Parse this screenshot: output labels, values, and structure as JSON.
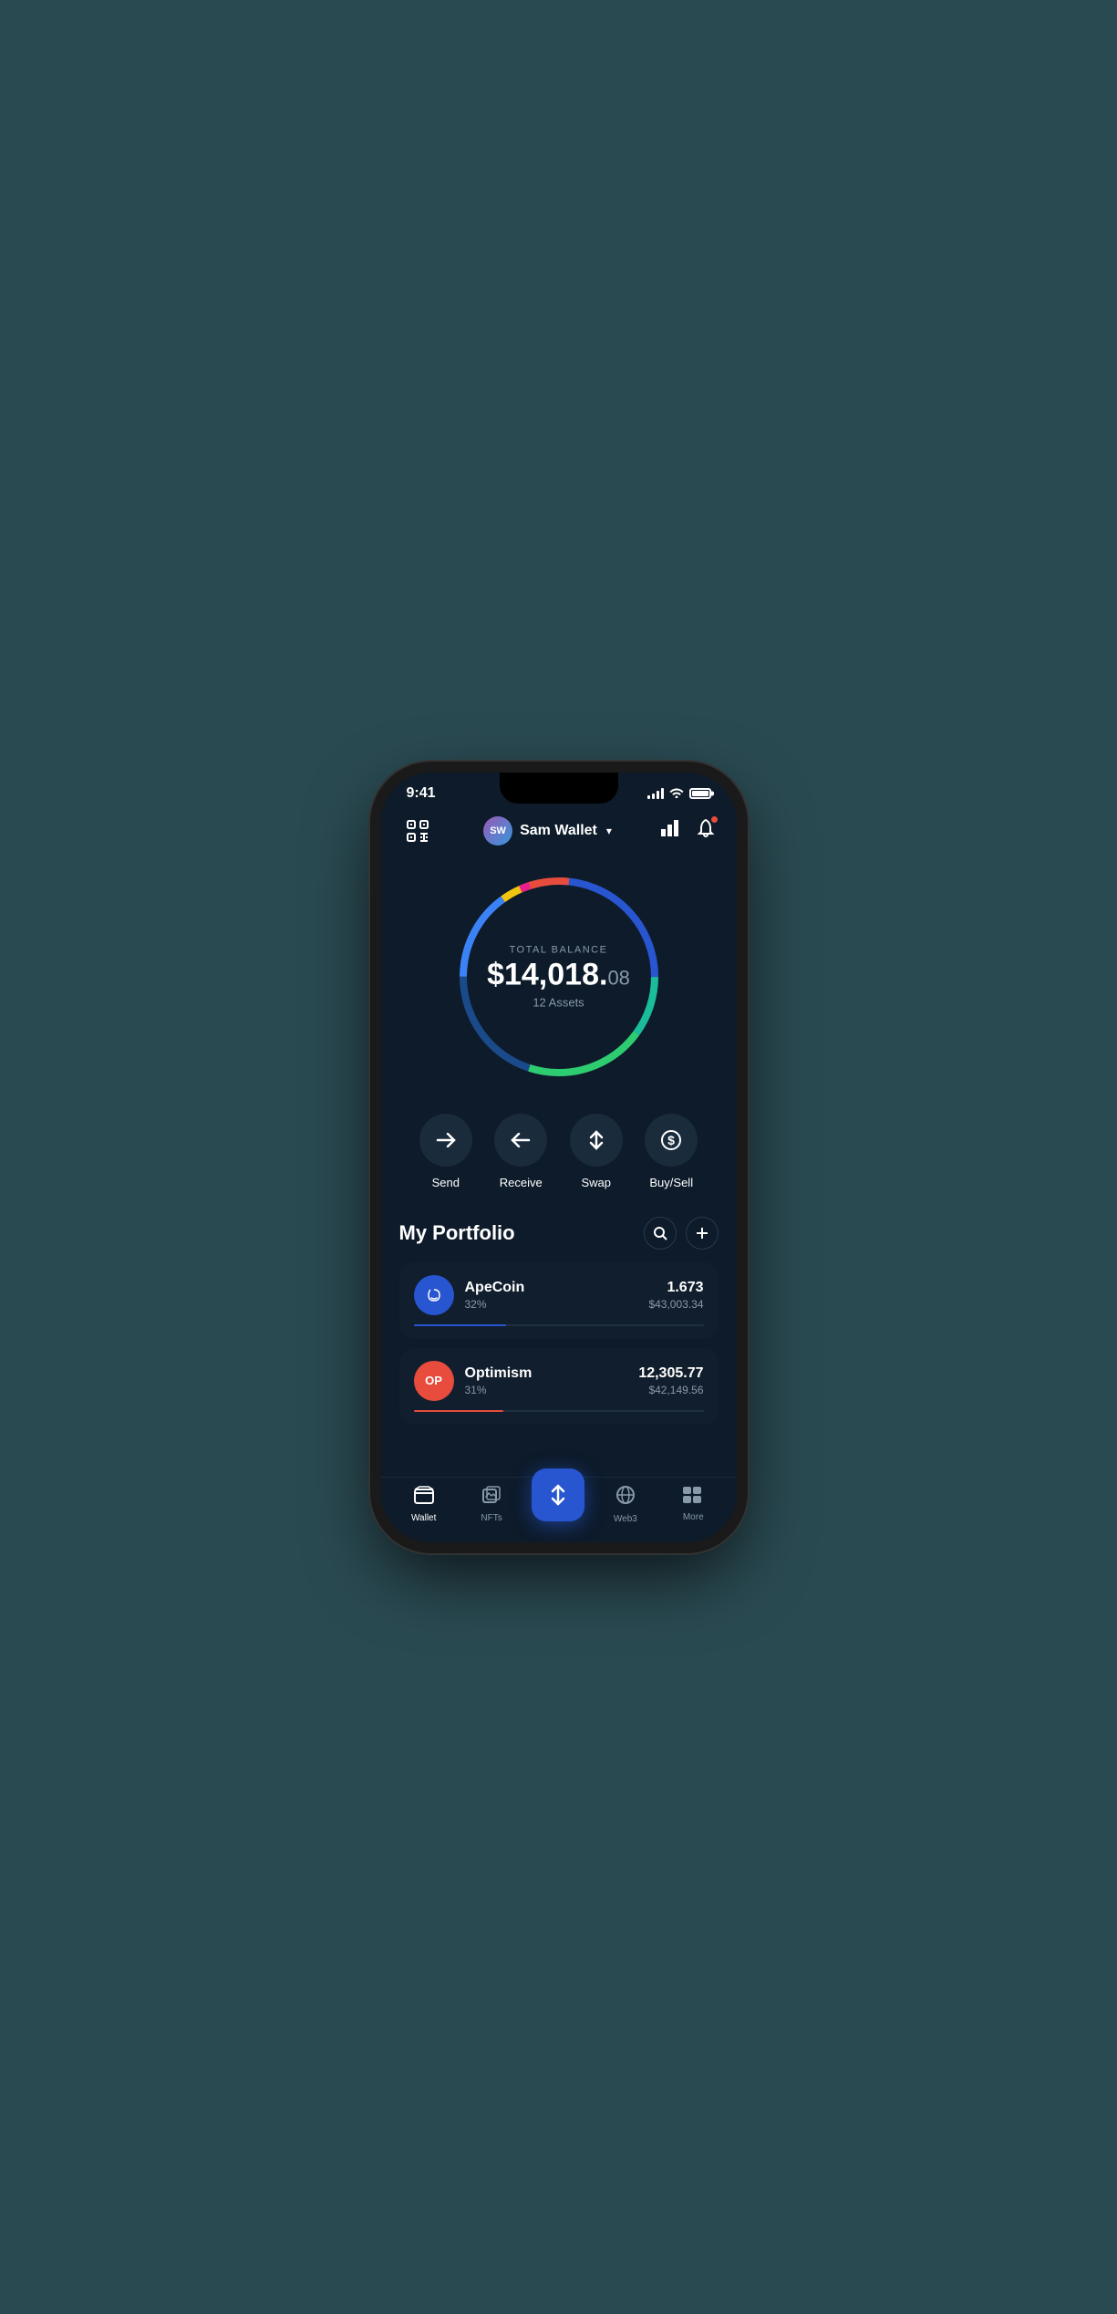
{
  "status_bar": {
    "time": "9:41"
  },
  "header": {
    "scan_label": "scan",
    "wallet_name": "Sam Wallet",
    "wallet_initials": "SW",
    "chevron": "▾",
    "notification_badge": true
  },
  "balance": {
    "label": "TOTAL BALANCE",
    "amount_main": "$14,018.",
    "amount_cents": "08",
    "assets_count": "12 Assets"
  },
  "actions": [
    {
      "id": "send",
      "label": "Send",
      "icon": "→"
    },
    {
      "id": "receive",
      "label": "Receive",
      "icon": "←"
    },
    {
      "id": "swap",
      "label": "Swap",
      "icon": "⇅"
    },
    {
      "id": "buysell",
      "label": "Buy/Sell",
      "icon": "$"
    }
  ],
  "portfolio": {
    "title": "My Portfolio",
    "search_label": "search",
    "add_label": "add"
  },
  "assets": [
    {
      "id": "apecoin",
      "name": "ApeCoin",
      "percentage": "32%",
      "amount": "1.673",
      "usd": "$43,003.34",
      "progress": 32,
      "progress_color": "#2855d0",
      "logo_type": "ape"
    },
    {
      "id": "optimism",
      "name": "Optimism",
      "percentage": "31%",
      "amount": "12,305.77",
      "usd": "$42,149.56",
      "progress": 31,
      "progress_color": "#e74c3c",
      "logo_type": "op"
    }
  ],
  "bottom_nav": [
    {
      "id": "wallet",
      "label": "Wallet",
      "icon": "wallet",
      "active": true
    },
    {
      "id": "nfts",
      "label": "NFTs",
      "icon": "nfts",
      "active": false
    },
    {
      "id": "center",
      "label": "",
      "icon": "swap-center",
      "active": false
    },
    {
      "id": "web3",
      "label": "Web3",
      "icon": "web3",
      "active": false
    },
    {
      "id": "more",
      "label": "More",
      "icon": "more",
      "active": false
    }
  ],
  "ring": {
    "segments": [
      {
        "color": "#e74c3c",
        "pct": 10
      },
      {
        "color": "#e91e8c",
        "pct": 8
      },
      {
        "color": "#f1c40f",
        "pct": 7
      },
      {
        "color": "#3498db",
        "pct": 20
      },
      {
        "color": "#2ecc71",
        "pct": 20
      },
      {
        "color": "#1abc9c",
        "pct": 10
      },
      {
        "color": "#2855d0",
        "pct": 25
      }
    ]
  }
}
